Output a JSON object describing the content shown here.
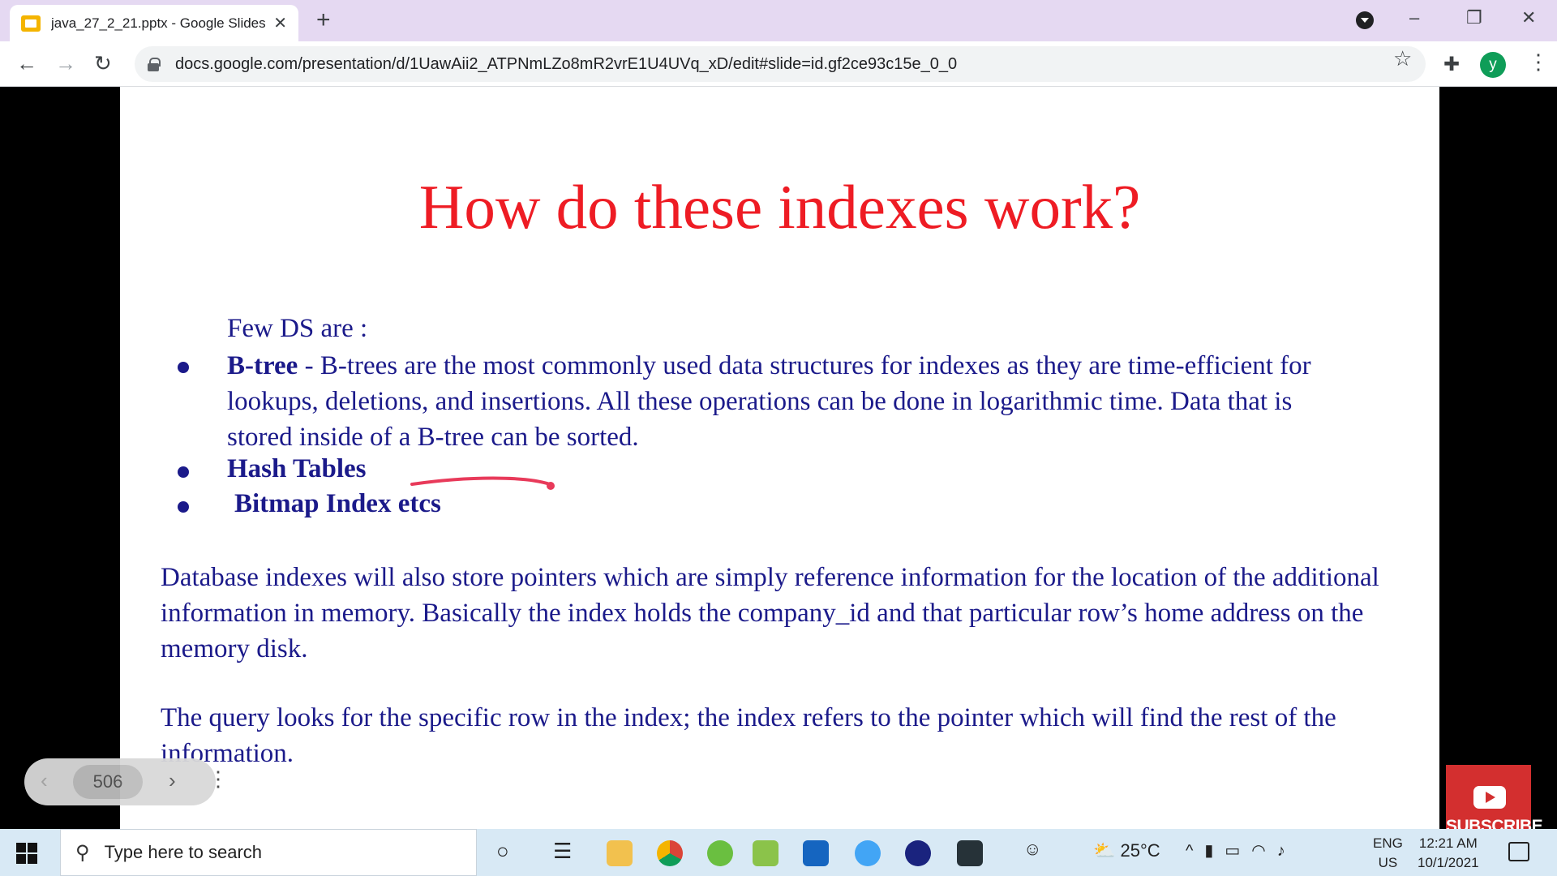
{
  "browser": {
    "tab_title": "java_27_2_21.pptx - Google Slides",
    "tab_close": "✕",
    "new_tab": "+",
    "url": "docs.google.com/presentation/d/1UawAii2_ATPNmLZo8mR2vrE1U4UVq_xD/edit#slide=id.gf2ce93c15e_0_0",
    "avatar_letter": "y",
    "window_minimize": "–",
    "window_restore": "❐",
    "window_close": "✕",
    "back": "←",
    "forward": "→",
    "reload": "↻",
    "star": "☆",
    "extensions": "✚",
    "menu": "⋮"
  },
  "slide": {
    "title": "How do these indexes work?",
    "intro": "Few DS are :",
    "bullets": {
      "b1_label": "B-tree",
      "b1_text": " -  B-trees are the most commonly used data structures for indexes as they are time-efficient for lookups, deletions, and insertions. All these operations can be done in logarithmic time. Data that is stored inside of a B-tree can be sorted.",
      "b2": "Hash Tables",
      "b3": "Bitmap Index etcs"
    },
    "para1": "Database indexes will also store pointers which are simply reference information for the location of the additional information in memory. Basically the index holds the company_id and that particular row’s home address on the memory disk.",
    "para2": "The query looks for the specific row in the index; the index refers to the pointer which will find the rest of the information."
  },
  "slide_nav": {
    "prev": "‹",
    "page": "506",
    "next": "›",
    "more": "⋮"
  },
  "subscribe": {
    "label": "SUBSCRIBE"
  },
  "taskbar": {
    "search_placeholder": "Type here to search",
    "weather": "25°C",
    "lang_top": "ENG",
    "lang_bottom": "US",
    "time": "12:21 AM",
    "date": "10/1/2021"
  }
}
